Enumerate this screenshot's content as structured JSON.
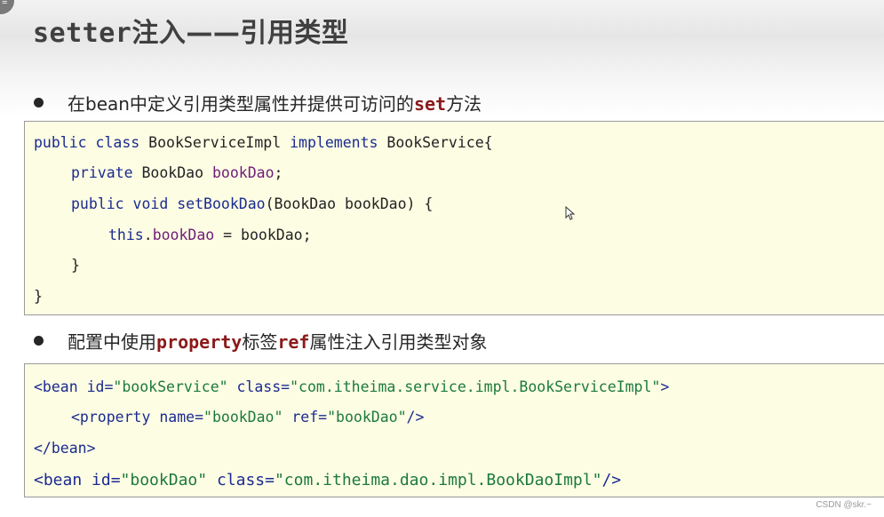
{
  "slide": {
    "title_code": "setter",
    "title_cn": "注入——引用类型",
    "corner_glyph": "≡",
    "watermark": "CSDN @skr.~"
  },
  "bullets": [
    {
      "pre": "在bean中定义引用类型属性并提供可访问的",
      "keyword": "set",
      "post": "方法"
    },
    {
      "pre": "配置中使用",
      "keyword": "property",
      "mid": "标签",
      "keyword2": "ref",
      "post": "属性注入引用类型对象"
    }
  ],
  "java_code": {
    "l1": {
      "public": "public",
      "class": "class",
      "name": "BookServiceImpl",
      "implements": "implements",
      "iface": "BookService{"
    },
    "l2": {
      "private": "private",
      "type": "BookDao",
      "field": "bookDao",
      "semi": ";"
    },
    "l3": {
      "public": "public",
      "void": "void",
      "method": "setBookDao",
      "params": "(BookDao bookDao) {"
    },
    "l4": {
      "this": "this",
      "dot": ".",
      "field": "bookDao",
      "rest": " = bookDao;"
    },
    "l5": "}",
    "l6": "}"
  },
  "xml_code": {
    "l1": {
      "open": "<bean",
      "id_attr": "id=",
      "id_val": "\"bookService\"",
      "class_attr": "class=",
      "class_val": "\"com.itheima.service.impl.BookServiceImpl\"",
      "close": ">"
    },
    "l2": {
      "open": "<property",
      "name_attr": "name=",
      "name_val": "\"bookDao\"",
      "ref_attr": "ref=",
      "ref_val": "\"bookDao\"",
      "close": "/>"
    },
    "l3": "</bean>",
    "l4": {
      "open": "<bean",
      "id_attr": "id=",
      "id_val": "\"bookDao\"",
      "class_attr": "class=",
      "class_val": "\"com.itheima.dao.impl.BookDaoImpl\"",
      "close": "/>"
    }
  },
  "icons": {
    "cursor": "mouse-pointer-icon"
  }
}
